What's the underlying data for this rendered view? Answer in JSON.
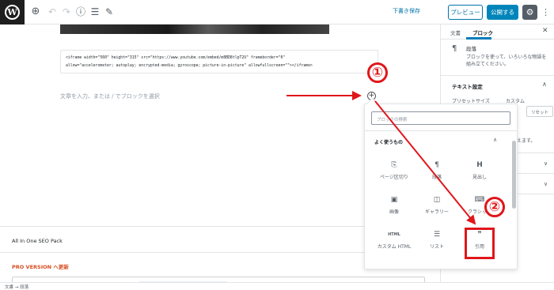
{
  "toolbar": {
    "logo": "W",
    "save_draft": "下書き保存",
    "preview": "プレビュー",
    "publish": "公開する",
    "icons": [
      "add-block-icon",
      "undo-icon",
      "redo-icon",
      "info-icon",
      "list-view-icon",
      "edit-icon",
      "gear-icon",
      "more-icon"
    ]
  },
  "editor": {
    "code_lines": [
      "<iframe width=\"560\" height=\"315\" src=\"https://www.youtube.com/embed/m8BD8tlpT2U\" frameborder=\"0\"",
      "allow=\"accelerometer; autoplay; encrypted-media; gyroscope; picture-in-picture\" allowfullscreen=\"\"></iframe>"
    ],
    "placeholder": "文章を入力、または / でブロックを選択"
  },
  "metabox": {
    "seo_title": "All In One SEO Pack",
    "pro_label": "PRO VERSION へ更新"
  },
  "sidebar": {
    "tab_document": "文書",
    "tab_block": "ブロック",
    "block_title": "段落",
    "block_desc": "ブロックを使って、いろいろな物語を組み立てください。",
    "text_settings": "テキスト設定",
    "preset_size": "プリセットサイズ",
    "custom": "カスタム",
    "reset": "リセット",
    "hint": "えます。"
  },
  "inserter": {
    "search_placeholder": "ブロックの検索",
    "common_label": "よく使うもの",
    "blocks": [
      {
        "label": "ページ区切り",
        "icon": "page-break-icon"
      },
      {
        "label": "段落",
        "icon": "paragraph-icon"
      },
      {
        "label": "見出し",
        "icon": "heading-icon"
      },
      {
        "label": "画像",
        "icon": "image-icon"
      },
      {
        "label": "ギャラリー",
        "icon": "gallery-icon"
      },
      {
        "label": "クラシック",
        "icon": "classic-icon"
      },
      {
        "label": "カスタム HTML",
        "icon": "html-icon"
      },
      {
        "label": "リスト",
        "icon": "list-icon"
      },
      {
        "label": "引用",
        "icon": "quote-icon"
      }
    ]
  },
  "annotations": {
    "one": "①",
    "two": "②",
    "color": "#e0161b"
  },
  "statusbar": {
    "breadcrumb": "文書 → 段落"
  }
}
